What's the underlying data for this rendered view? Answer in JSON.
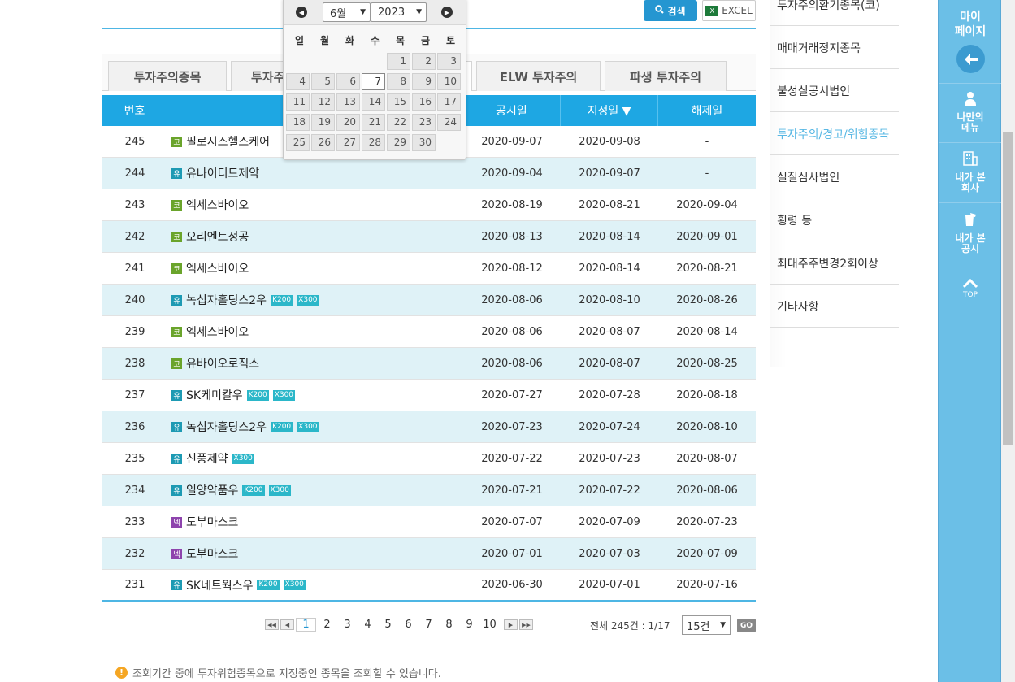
{
  "toolbar": {
    "search_label": "검색",
    "excel_label": "EXCEL"
  },
  "tabs": [
    {
      "label": "투자주의종목"
    },
    {
      "label": "투자주의"
    },
    {
      "label": ""
    },
    {
      "label": "ELW 투자주의"
    },
    {
      "label": "파생 투자주의"
    }
  ],
  "table": {
    "headers": [
      "번호",
      "",
      "공시일",
      "지정일 ▼",
      "해제일"
    ],
    "rows": [
      {
        "no": "245",
        "mk": "코",
        "mc": "g",
        "name": "필로시스헬스케어",
        "badges": [],
        "pub": "2020-09-07",
        "des": "2020-09-08",
        "rel": "-"
      },
      {
        "no": "244",
        "mk": "유",
        "mc": "t",
        "name": "유나이티드제약",
        "badges": [],
        "pub": "2020-09-04",
        "des": "2020-09-07",
        "rel": "-"
      },
      {
        "no": "243",
        "mk": "코",
        "mc": "g",
        "name": "엑세스바이오",
        "badges": [],
        "pub": "2020-08-19",
        "des": "2020-08-21",
        "rel": "2020-09-04"
      },
      {
        "no": "242",
        "mk": "코",
        "mc": "g",
        "name": "오리엔트정공",
        "badges": [],
        "pub": "2020-08-13",
        "des": "2020-08-14",
        "rel": "2020-09-01"
      },
      {
        "no": "241",
        "mk": "코",
        "mc": "g",
        "name": "엑세스바이오",
        "badges": [],
        "pub": "2020-08-12",
        "des": "2020-08-14",
        "rel": "2020-08-21"
      },
      {
        "no": "240",
        "mk": "유",
        "mc": "t",
        "name": "녹십자홀딩스2우",
        "badges": [
          "K200",
          "X300"
        ],
        "pub": "2020-08-06",
        "des": "2020-08-10",
        "rel": "2020-08-26"
      },
      {
        "no": "239",
        "mk": "코",
        "mc": "g",
        "name": "엑세스바이오",
        "badges": [],
        "pub": "2020-08-06",
        "des": "2020-08-07",
        "rel": "2020-08-14"
      },
      {
        "no": "238",
        "mk": "코",
        "mc": "g",
        "name": "유바이오로직스",
        "badges": [],
        "pub": "2020-08-06",
        "des": "2020-08-07",
        "rel": "2020-08-25"
      },
      {
        "no": "237",
        "mk": "유",
        "mc": "t",
        "name": "SK케미칼우",
        "badges": [
          "K200",
          "X300"
        ],
        "pub": "2020-07-27",
        "des": "2020-07-28",
        "rel": "2020-08-18"
      },
      {
        "no": "236",
        "mk": "유",
        "mc": "t",
        "name": "녹십자홀딩스2우",
        "badges": [
          "K200",
          "X300"
        ],
        "pub": "2020-07-23",
        "des": "2020-07-24",
        "rel": "2020-08-10"
      },
      {
        "no": "235",
        "mk": "유",
        "mc": "t",
        "name": "신풍제약",
        "badges": [
          "X300"
        ],
        "pub": "2020-07-22",
        "des": "2020-07-23",
        "rel": "2020-08-07"
      },
      {
        "no": "234",
        "mk": "유",
        "mc": "t",
        "name": "일양약품우",
        "badges": [
          "K200",
          "X300"
        ],
        "pub": "2020-07-21",
        "des": "2020-07-22",
        "rel": "2020-08-06"
      },
      {
        "no": "233",
        "mk": "넥",
        "mc": "p",
        "name": "도부마스크",
        "badges": [],
        "pub": "2020-07-07",
        "des": "2020-07-09",
        "rel": "2020-07-23"
      },
      {
        "no": "232",
        "mk": "넥",
        "mc": "p",
        "name": "도부마스크",
        "badges": [],
        "pub": "2020-07-01",
        "des": "2020-07-03",
        "rel": "2020-07-09"
      },
      {
        "no": "231",
        "mk": "유",
        "mc": "t",
        "name": "SK네트웍스우",
        "badges": [
          "K200",
          "X300"
        ],
        "pub": "2020-06-30",
        "des": "2020-07-01",
        "rel": "2020-07-16"
      }
    ]
  },
  "calendar": {
    "month": "6월",
    "year": "2023",
    "dows": [
      "일",
      "월",
      "화",
      "수",
      "목",
      "금",
      "토"
    ],
    "days": [
      "1",
      "2",
      "3",
      "4",
      "5",
      "6",
      "7",
      "8",
      "9",
      "10",
      "11",
      "12",
      "13",
      "14",
      "15",
      "16",
      "17",
      "18",
      "19",
      "20",
      "21",
      "22",
      "23",
      "24",
      "25",
      "26",
      "27",
      "28",
      "29",
      "30"
    ],
    "today": "7"
  },
  "pager": {
    "pages": [
      "1",
      "2",
      "3",
      "4",
      "5",
      "6",
      "7",
      "8",
      "9",
      "10"
    ],
    "current": "1",
    "total": "전체 245건 : 1/17",
    "per_page": "15건",
    "go": "GO"
  },
  "note": "조회기간 중에 투자위험종목으로 지정중인 종목을 조회할 수 있습니다.",
  "right_menu": [
    {
      "label": "투자주의환기종목(코)"
    },
    {
      "label": "매매거래정지종목"
    },
    {
      "label": "불성실공시법인"
    },
    {
      "label": "투자주의/경고/위험종목"
    },
    {
      "label": "실질심사법인"
    },
    {
      "label": "횡령 등"
    },
    {
      "label": "최대주주변경2회이상"
    },
    {
      "label": "기타사항"
    }
  ],
  "side": {
    "title": "마이\n페이지",
    "blocks": [
      {
        "label": "나만의\n메뉴",
        "icon": "person-icon"
      },
      {
        "label": "내가 본\n회사",
        "icon": "building-icon"
      },
      {
        "label": "내가 본\n공시",
        "icon": "cup-icon"
      }
    ],
    "top": "TOP"
  },
  "colors": {
    "accent": "#1ea7e3",
    "row_alt": "#dff2f7",
    "side": "#6bbfe7"
  }
}
